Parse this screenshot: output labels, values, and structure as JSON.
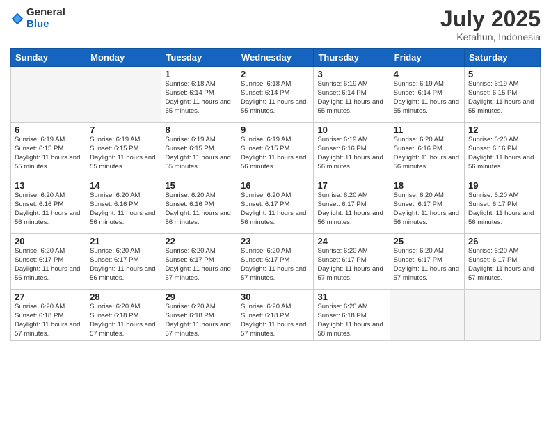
{
  "logo": {
    "general": "General",
    "blue": "Blue"
  },
  "title": "July 2025",
  "location": "Ketahun, Indonesia",
  "headers": [
    "Sunday",
    "Monday",
    "Tuesday",
    "Wednesday",
    "Thursday",
    "Friday",
    "Saturday"
  ],
  "weeks": [
    [
      {
        "day": "",
        "info": ""
      },
      {
        "day": "",
        "info": ""
      },
      {
        "day": "1",
        "info": "Sunrise: 6:18 AM\nSunset: 6:14 PM\nDaylight: 11 hours and 55 minutes."
      },
      {
        "day": "2",
        "info": "Sunrise: 6:18 AM\nSunset: 6:14 PM\nDaylight: 11 hours and 55 minutes."
      },
      {
        "day": "3",
        "info": "Sunrise: 6:19 AM\nSunset: 6:14 PM\nDaylight: 11 hours and 55 minutes."
      },
      {
        "day": "4",
        "info": "Sunrise: 6:19 AM\nSunset: 6:14 PM\nDaylight: 11 hours and 55 minutes."
      },
      {
        "day": "5",
        "info": "Sunrise: 6:19 AM\nSunset: 6:15 PM\nDaylight: 11 hours and 55 minutes."
      }
    ],
    [
      {
        "day": "6",
        "info": "Sunrise: 6:19 AM\nSunset: 6:15 PM\nDaylight: 11 hours and 55 minutes."
      },
      {
        "day": "7",
        "info": "Sunrise: 6:19 AM\nSunset: 6:15 PM\nDaylight: 11 hours and 55 minutes."
      },
      {
        "day": "8",
        "info": "Sunrise: 6:19 AM\nSunset: 6:15 PM\nDaylight: 11 hours and 55 minutes."
      },
      {
        "day": "9",
        "info": "Sunrise: 6:19 AM\nSunset: 6:15 PM\nDaylight: 11 hours and 56 minutes."
      },
      {
        "day": "10",
        "info": "Sunrise: 6:19 AM\nSunset: 6:16 PM\nDaylight: 11 hours and 56 minutes."
      },
      {
        "day": "11",
        "info": "Sunrise: 6:20 AM\nSunset: 6:16 PM\nDaylight: 11 hours and 56 minutes."
      },
      {
        "day": "12",
        "info": "Sunrise: 6:20 AM\nSunset: 6:16 PM\nDaylight: 11 hours and 56 minutes."
      }
    ],
    [
      {
        "day": "13",
        "info": "Sunrise: 6:20 AM\nSunset: 6:16 PM\nDaylight: 11 hours and 56 minutes."
      },
      {
        "day": "14",
        "info": "Sunrise: 6:20 AM\nSunset: 6:16 PM\nDaylight: 11 hours and 56 minutes."
      },
      {
        "day": "15",
        "info": "Sunrise: 6:20 AM\nSunset: 6:16 PM\nDaylight: 11 hours and 56 minutes."
      },
      {
        "day": "16",
        "info": "Sunrise: 6:20 AM\nSunset: 6:17 PM\nDaylight: 11 hours and 56 minutes."
      },
      {
        "day": "17",
        "info": "Sunrise: 6:20 AM\nSunset: 6:17 PM\nDaylight: 11 hours and 56 minutes."
      },
      {
        "day": "18",
        "info": "Sunrise: 6:20 AM\nSunset: 6:17 PM\nDaylight: 11 hours and 56 minutes."
      },
      {
        "day": "19",
        "info": "Sunrise: 6:20 AM\nSunset: 6:17 PM\nDaylight: 11 hours and 56 minutes."
      }
    ],
    [
      {
        "day": "20",
        "info": "Sunrise: 6:20 AM\nSunset: 6:17 PM\nDaylight: 11 hours and 56 minutes."
      },
      {
        "day": "21",
        "info": "Sunrise: 6:20 AM\nSunset: 6:17 PM\nDaylight: 11 hours and 56 minutes."
      },
      {
        "day": "22",
        "info": "Sunrise: 6:20 AM\nSunset: 6:17 PM\nDaylight: 11 hours and 57 minutes."
      },
      {
        "day": "23",
        "info": "Sunrise: 6:20 AM\nSunset: 6:17 PM\nDaylight: 11 hours and 57 minutes."
      },
      {
        "day": "24",
        "info": "Sunrise: 6:20 AM\nSunset: 6:17 PM\nDaylight: 11 hours and 57 minutes."
      },
      {
        "day": "25",
        "info": "Sunrise: 6:20 AM\nSunset: 6:17 PM\nDaylight: 11 hours and 57 minutes."
      },
      {
        "day": "26",
        "info": "Sunrise: 6:20 AM\nSunset: 6:17 PM\nDaylight: 11 hours and 57 minutes."
      }
    ],
    [
      {
        "day": "27",
        "info": "Sunrise: 6:20 AM\nSunset: 6:18 PM\nDaylight: 11 hours and 57 minutes."
      },
      {
        "day": "28",
        "info": "Sunrise: 6:20 AM\nSunset: 6:18 PM\nDaylight: 11 hours and 57 minutes."
      },
      {
        "day": "29",
        "info": "Sunrise: 6:20 AM\nSunset: 6:18 PM\nDaylight: 11 hours and 57 minutes."
      },
      {
        "day": "30",
        "info": "Sunrise: 6:20 AM\nSunset: 6:18 PM\nDaylight: 11 hours and 57 minutes."
      },
      {
        "day": "31",
        "info": "Sunrise: 6:20 AM\nSunset: 6:18 PM\nDaylight: 11 hours and 58 minutes."
      },
      {
        "day": "",
        "info": ""
      },
      {
        "day": "",
        "info": ""
      }
    ]
  ]
}
